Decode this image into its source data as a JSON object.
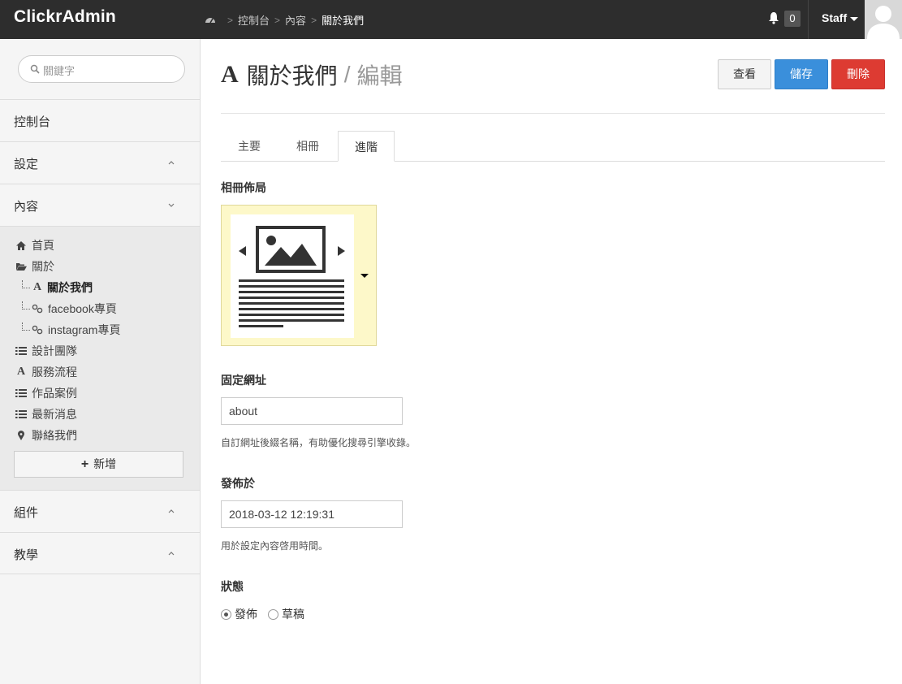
{
  "app": {
    "brand": "ClickrAdmin"
  },
  "breadcrumb": {
    "items": [
      "控制台",
      "內容",
      "關於我們"
    ]
  },
  "header": {
    "notif_count": "0",
    "user": "Staff"
  },
  "sidebar": {
    "search_placeholder": "關鍵字",
    "sections": [
      {
        "label": "控制台"
      },
      {
        "label": "設定"
      },
      {
        "label": "內容"
      },
      {
        "label": "組件"
      },
      {
        "label": "教學"
      }
    ],
    "content_items": [
      {
        "label": "首頁",
        "icon": "home-icon"
      },
      {
        "label": "關於",
        "icon": "folder-open-icon"
      },
      {
        "label": "關於我們",
        "icon": "text-page-icon"
      },
      {
        "label": "facebook專頁",
        "icon": "link-icon"
      },
      {
        "label": "instagram專頁",
        "icon": "link-icon"
      },
      {
        "label": "設計團隊",
        "icon": "list-icon"
      },
      {
        "label": "服務流程",
        "icon": "text-page-icon"
      },
      {
        "label": "作品案例",
        "icon": "list-icon"
      },
      {
        "label": "最新消息",
        "icon": "list-icon"
      },
      {
        "label": "聯絡我們",
        "icon": "map-marker-icon"
      }
    ],
    "add_label": "新增"
  },
  "page": {
    "title": "關於我們",
    "title_sub": "編輯",
    "buttons": {
      "view": "查看",
      "save": "儲存",
      "delete": "刪除"
    },
    "tabs": [
      "主要",
      "相冊",
      "進階"
    ],
    "active_tab": "進階",
    "gallery_layout_label": "相冊佈局",
    "permalink_label": "固定網址",
    "permalink_value": "about",
    "permalink_help": "自訂網址後綴名稱，有助優化搜尋引擎收錄。",
    "published_label": "發佈於",
    "published_value": "2018-03-12 12:19:31",
    "published_help": "用於設定內容啓用時間。",
    "status_label": "狀態",
    "status_options": [
      "發佈",
      "草稿"
    ],
    "status_selected": "發佈"
  },
  "colors": {
    "save": "#3a8fdb",
    "delete": "#dd3b32",
    "topbar": "#2d2d2d",
    "layout_bg": "#fdf8c9"
  }
}
